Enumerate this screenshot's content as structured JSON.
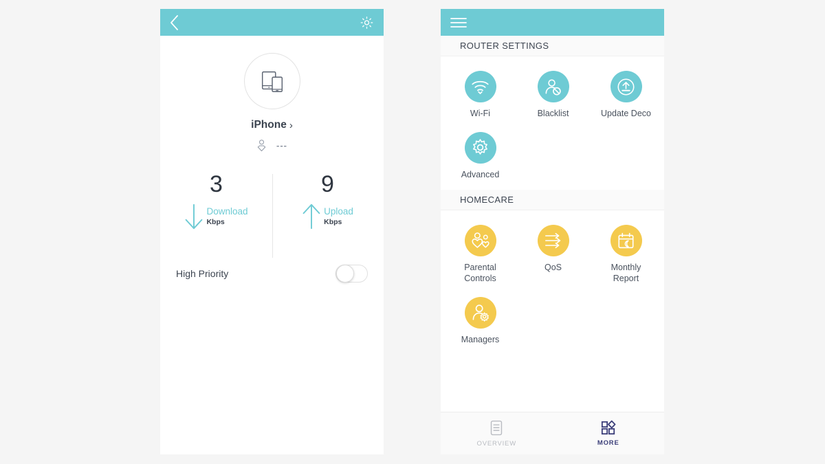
{
  "left_phone": {
    "topbar": {
      "back_icon": "chevron-left-icon",
      "settings_icon": "gear-icon"
    },
    "device": {
      "avatar_icon": "tablet-phone-icon",
      "name": "iPhone",
      "chevron": "›",
      "owner_icon": "owner-person-icon",
      "owner_value": "---"
    },
    "stats": [
      {
        "value": "3",
        "label": "Download",
        "unit": "Kbps",
        "icon": "arrow-down-icon"
      },
      {
        "value": "9",
        "label": "Upload",
        "unit": "Kbps",
        "icon": "arrow-up-icon"
      }
    ],
    "priority": {
      "label": "High Priority",
      "toggle_state": "off"
    }
  },
  "right_phone": {
    "topbar": {
      "menu_icon": "hamburger-menu-icon"
    },
    "sections": [
      {
        "title": "ROUTER SETTINGS",
        "color": "teal",
        "tiles": [
          {
            "label": "Wi-Fi",
            "icon": "wifi-icon"
          },
          {
            "label": "Blacklist",
            "icon": "user-blocked-icon"
          },
          {
            "label": "Update Deco",
            "icon": "upload-circle-icon"
          },
          {
            "label": "Advanced",
            "icon": "gear-icon"
          }
        ]
      },
      {
        "title": "HOMECARE",
        "color": "yellow",
        "tiles": [
          {
            "label": "Parental\nControls",
            "icon": "parental-controls-icon"
          },
          {
            "label": "QoS",
            "icon": "qos-arrows-icon"
          },
          {
            "label": "Monthly\nReport",
            "icon": "calendar-moon-icon"
          },
          {
            "label": "Managers",
            "icon": "user-gear-icon"
          }
        ]
      }
    ],
    "bottom_nav": [
      {
        "label": "OVERVIEW",
        "icon": "document-list-icon",
        "active": false
      },
      {
        "label": "MORE",
        "icon": "grid-more-icon",
        "active": true
      }
    ]
  },
  "colors": {
    "teal": "#6ECBD4",
    "yellow": "#F4CA4E",
    "nav_active": "#3C3F7A",
    "text_dark": "#3C4450",
    "page_background": "#F5F5F5"
  }
}
